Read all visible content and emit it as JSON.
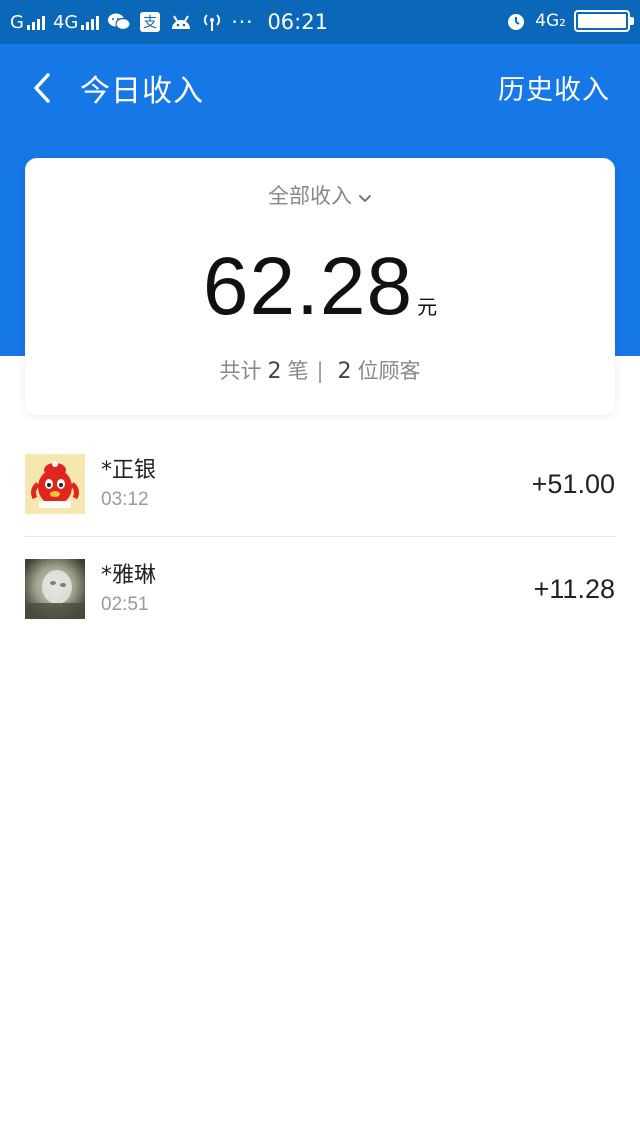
{
  "status_bar": {
    "carrier_1": "G",
    "carrier_2": "4G",
    "wechat_icon": "wechat-icon",
    "alipay_icon": "alipay-icon",
    "android_icon": "android-icon",
    "hotspot_icon": "hotspot-icon",
    "more": "···",
    "time": "06:21",
    "alarm_icon": "alarm-icon",
    "network": "4G₂",
    "battery_level": 1.0
  },
  "header": {
    "back_icon": "chevron-left-icon",
    "title": "今日收入",
    "history_label": "历史收入"
  },
  "summary": {
    "filter_label": "全部收入",
    "amount": "62.28",
    "unit": "元",
    "stats_prefix": "共计",
    "transaction_count": "2",
    "transaction_unit": "笔",
    "separator": "|",
    "customer_count": "2",
    "customer_unit": "位顾客"
  },
  "transactions": [
    {
      "name": "*正银",
      "time": "03:12",
      "amount": "+51.00",
      "avatar": "cartoon-avatar"
    },
    {
      "name": "*雅琳",
      "time": "02:51",
      "amount": "+11.28",
      "avatar": "photo-avatar"
    }
  ],
  "colors": {
    "status_bar": "#0b68b8",
    "header": "#1677e6",
    "card": "#ffffff",
    "muted_text": "#888888"
  }
}
